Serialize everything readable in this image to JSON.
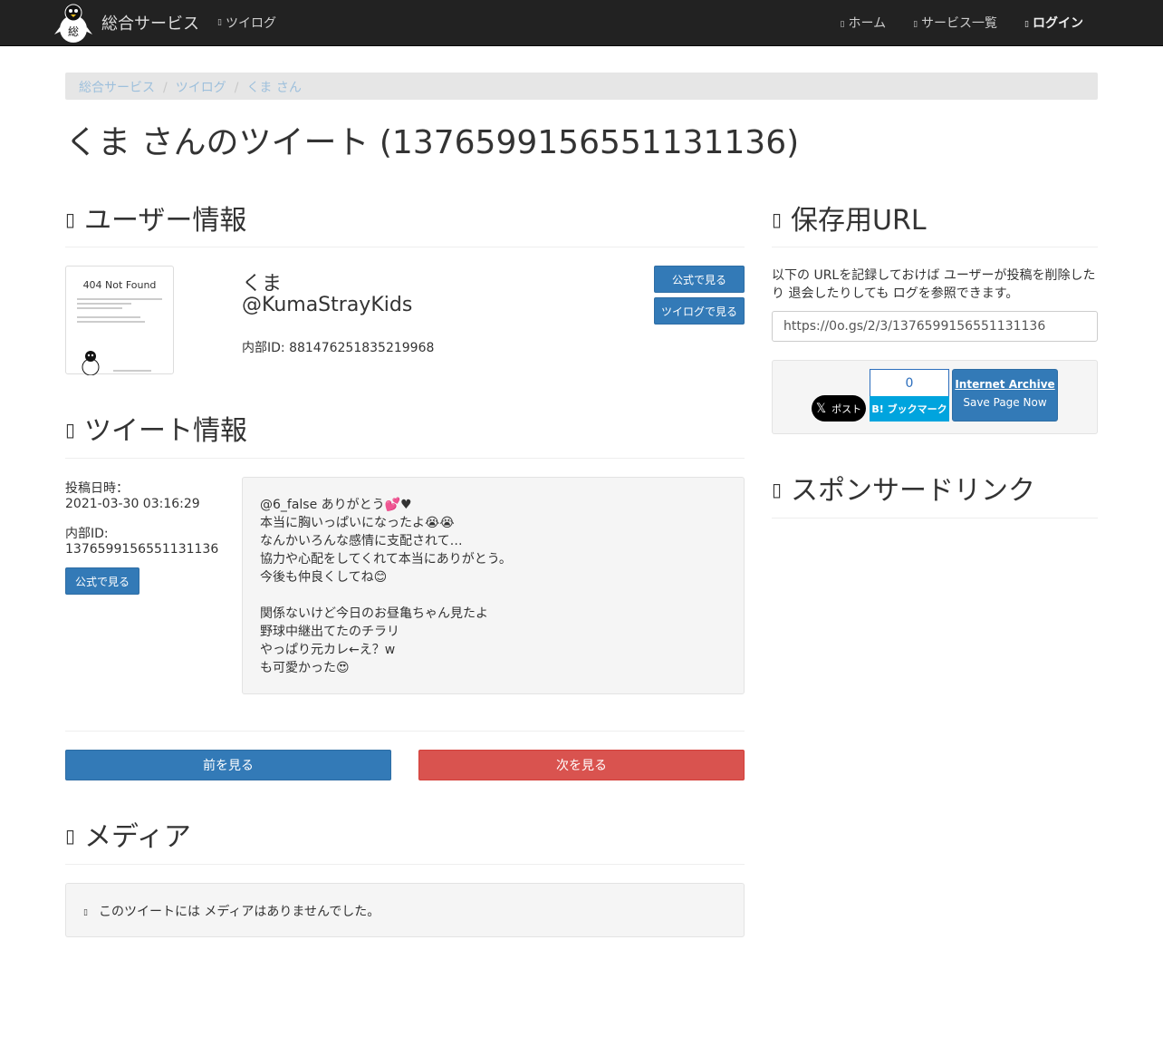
{
  "navbar": {
    "brand": "総合サービス",
    "left_link": "ツイログ",
    "right_links": [
      "ホーム",
      "サービス一覧",
      "ログイン"
    ]
  },
  "breadcrumb": [
    "総合サービス",
    "ツイログ",
    "くま さん"
  ],
  "page_title": "くま さんのツイート (1376599156551131136)",
  "user_section": {
    "title": "ユーザー情報",
    "thumb_text": "404 Not Found",
    "name": "くま",
    "handle": "@KumaStrayKids",
    "internal_id": "内部ID: 881476251835219968",
    "btn_official": "公式で見る",
    "btn_twilog": "ツイログで見る"
  },
  "tweet_section": {
    "title": "ツイート情報",
    "posted_label": "投稿日時：",
    "posted_value": "2021-03-30 03:16:29",
    "id_label": "内部ID:",
    "id_value": "1376599156551131136",
    "btn_official": "公式で見る",
    "text": "@6_false ありがとう💕♥\n本当に胸いっぱいになったよ😭😭\nなんかいろんな感情に支配されて…\n協力や心配をしてくれて本当にありがとう。\n今後も仲良くしてね😊\n\n関係ないけど今日のお昼亀ちゃん見たよ\n野球中継出てたのチラリ\nやっぱり元カレ←え？w\nも可愛かった😍"
  },
  "nav_buttons": {
    "prev": "前を見る",
    "next": "次を見る"
  },
  "media_section": {
    "title": "メディア",
    "empty_text": "このツイートには メディアはありませんでした。"
  },
  "save_section": {
    "title": "保存用URL",
    "description": "以下の URLを記録しておけば ユーザーが投稿を削除したり 退会したりしても ログを参照できます。",
    "url": "https://0o.gs/2/3/1376599156551131136",
    "x_button": "ポスト",
    "hatena_count": "0",
    "hatena_label": "B! ブックマーク",
    "ia_title": "Internet Archive",
    "ia_sub": "Save Page Now"
  },
  "sponsor_section": {
    "title": "スポンサードリンク"
  }
}
